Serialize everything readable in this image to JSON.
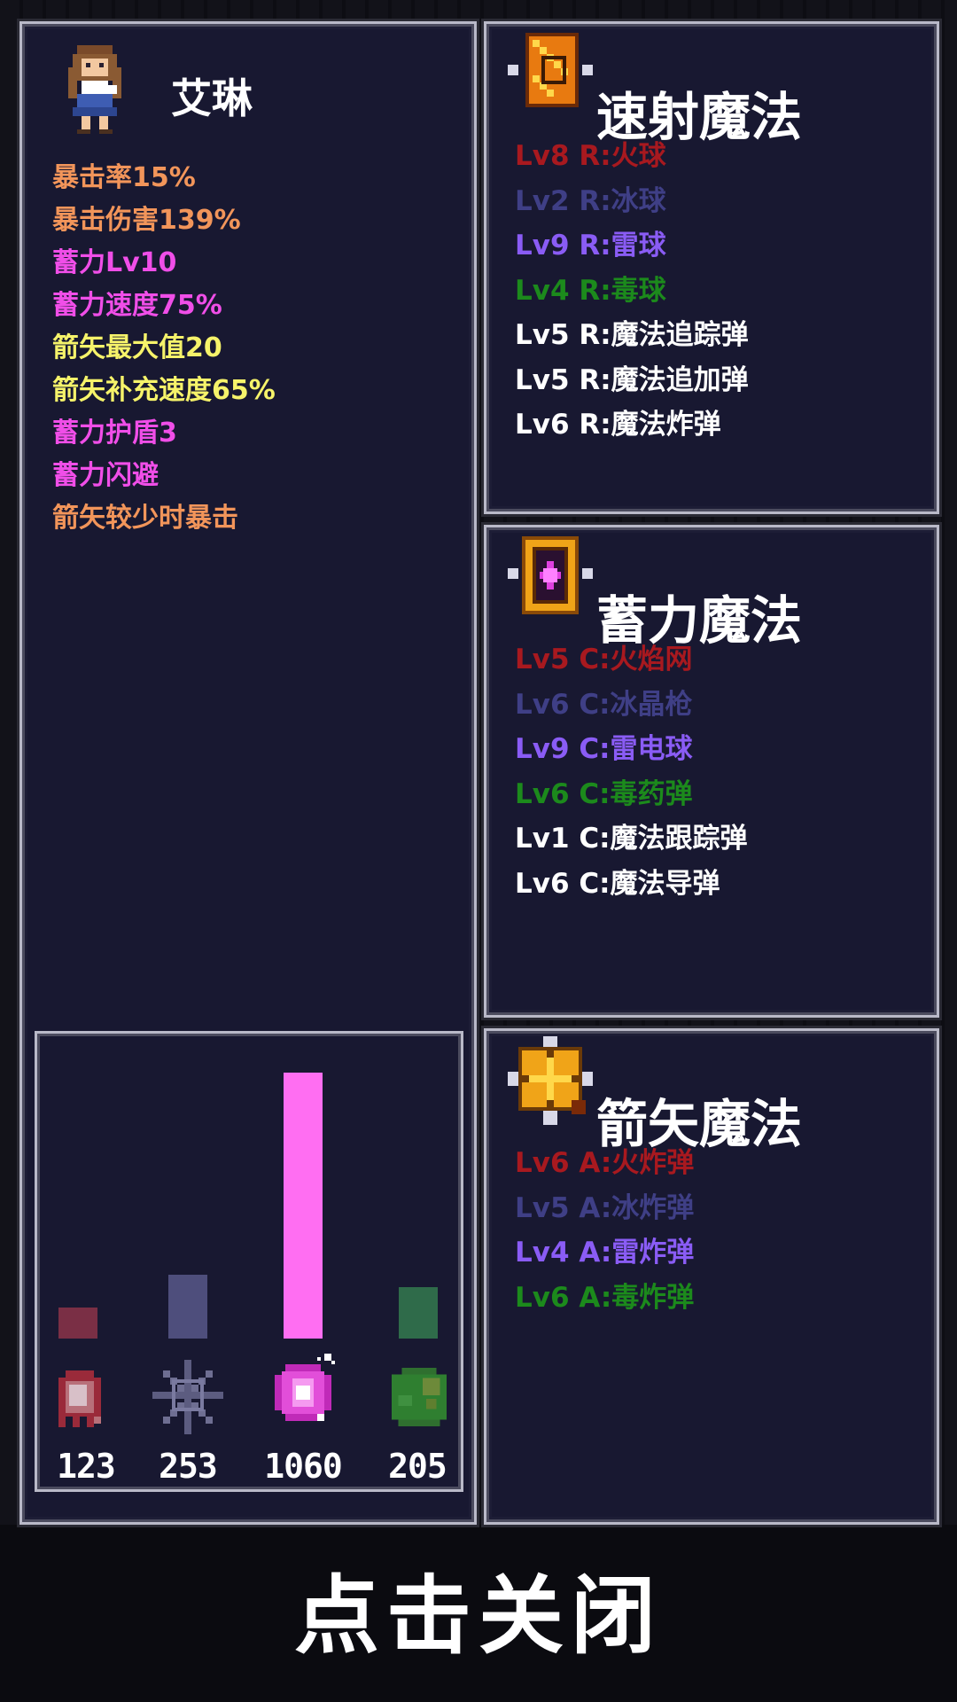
{
  "character": {
    "name": "艾琳",
    "stats": [
      {
        "text": "暴击率15%",
        "color": "#f2955a"
      },
      {
        "text": "暴击伤害139%",
        "color": "#f2955a"
      },
      {
        "text": "蓄力Lv10",
        "color": "#f04ee8"
      },
      {
        "text": "蓄力速度75%",
        "color": "#f04ee8"
      },
      {
        "text": "箭矢最大值20",
        "color": "#f6f36a"
      },
      {
        "text": "箭矢补充速度65%",
        "color": "#f6f36a"
      },
      {
        "text": "蓄力护盾3",
        "color": "#f04ee8"
      },
      {
        "text": "蓄力闪避",
        "color": "#f04ee8"
      },
      {
        "text": "箭矢较少时暴击",
        "color": "#f2955a"
      }
    ]
  },
  "elements_chart": {
    "items": [
      {
        "icon": "fire-ghost-icon",
        "count": "123",
        "value": 123,
        "color": "#7a2f45"
      },
      {
        "icon": "ice-snowflake-icon",
        "count": "253",
        "value": 253,
        "color": "#4e4e7c"
      },
      {
        "icon": "thunder-orb-icon",
        "count": "1060",
        "value": 1060,
        "color": "#ff6ef2"
      },
      {
        "icon": "poison-slime-icon",
        "count": "205",
        "value": 205,
        "color": "#2f6b4a"
      }
    ]
  },
  "rapid_magic": {
    "title": "速射魔法",
    "icon": "rapid-scroll-icon",
    "skills": [
      {
        "text": "Lv8 R:火球",
        "color": "#a8191f"
      },
      {
        "text": "Lv2 R:冰球",
        "color": "#3f3f86"
      },
      {
        "text": "Lv9 R:雷球",
        "color": "#8a5cf5"
      },
      {
        "text": "Lv4 R:毒球",
        "color": "#1c8a1c"
      },
      {
        "text": "Lv5 R:魔法追踪弹",
        "color": "#ffffff"
      },
      {
        "text": "Lv5 R:魔法追加弹",
        "color": "#ffffff"
      },
      {
        "text": "Lv6 R:魔法炸弹",
        "color": "#ffffff"
      }
    ]
  },
  "charge_magic": {
    "title": "蓄力魔法",
    "icon": "charge-crest-icon",
    "skills": [
      {
        "text": "Lv5 C:火焰网",
        "color": "#a8191f"
      },
      {
        "text": "Lv6 C:冰晶枪",
        "color": "#3f3f86"
      },
      {
        "text": "Lv9 C:雷电球",
        "color": "#8a5cf5"
      },
      {
        "text": "Lv6 C:毒药弹",
        "color": "#1c8a1c"
      },
      {
        "text": "Lv1 C:魔法跟踪弹",
        "color": "#ffffff"
      },
      {
        "text": "Lv6 C:魔法导弹",
        "color": "#ffffff"
      }
    ]
  },
  "arrow_magic": {
    "title": "箭矢魔法",
    "icon": "arrow-crossbow-icon",
    "skills": [
      {
        "text": "Lv6 A:火炸弹",
        "color": "#a8191f"
      },
      {
        "text": "Lv5 A:冰炸弹",
        "color": "#3f3f86"
      },
      {
        "text": "Lv4 A:雷炸弹",
        "color": "#8a5cf5"
      },
      {
        "text": "Lv6 A:毒炸弹",
        "color": "#1c8a1c"
      }
    ]
  },
  "close_label": "点击关闭"
}
